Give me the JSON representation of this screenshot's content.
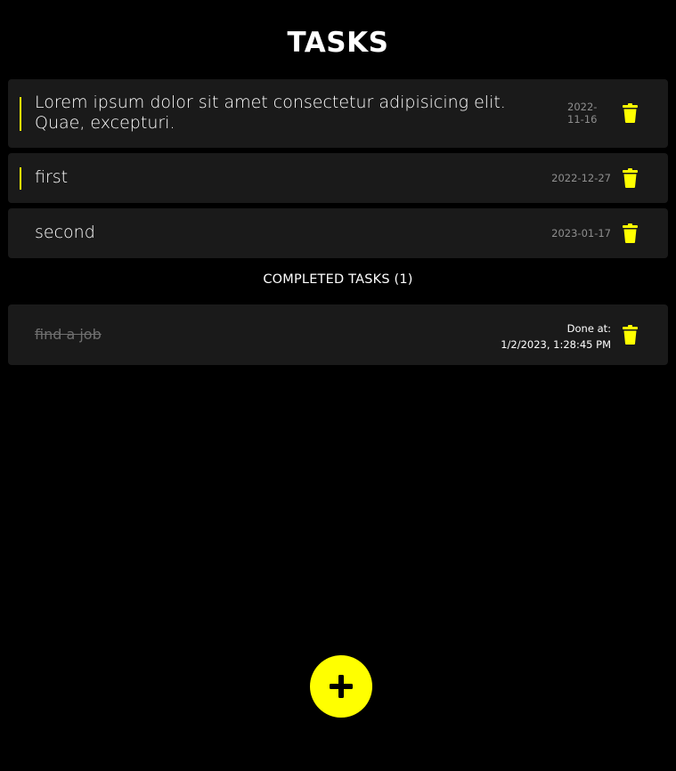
{
  "header": {
    "title": "TASKS"
  },
  "accent_color": "#ffff00",
  "tasks": [
    {
      "text": "Lorem ipsum dolor sit amet consectetur adipisicing elit. Quae, excepturi.",
      "date": "2022-11-16"
    },
    {
      "text": "first",
      "date": "2022-12-27"
    },
    {
      "text": "second",
      "date": "2023-01-17"
    }
  ],
  "completed": {
    "header": "COMPLETED TASKS (1)",
    "items": [
      {
        "text": "find a job",
        "done_label": "Done at:",
        "done_at": "1/2/2023, 1:28:45 PM"
      }
    ]
  },
  "icons": {
    "delete": "trash-icon",
    "add": "plus-icon"
  }
}
